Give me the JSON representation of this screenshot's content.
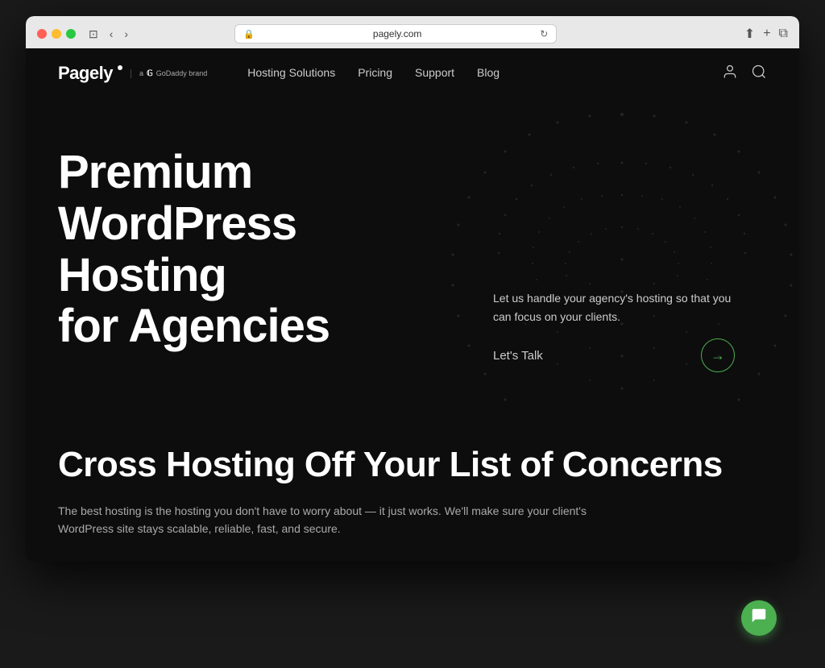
{
  "browser": {
    "url": "pagely.com",
    "tab_title": "pagely.com",
    "back_label": "‹",
    "forward_label": "›",
    "refresh_label": "↻"
  },
  "nav": {
    "logo": "Pagely",
    "godaddy_prefix": "a",
    "godaddy_label": "GoDaddy brand",
    "links": [
      {
        "label": "Hosting Solutions",
        "href": "#"
      },
      {
        "label": "Pricing",
        "href": "#"
      },
      {
        "label": "Support",
        "href": "#"
      },
      {
        "label": "Blog",
        "href": "#"
      }
    ]
  },
  "hero": {
    "title_line1": "Premium",
    "title_line2": "WordPress Hosting",
    "title_line3": "for Agencies",
    "description": "Let us handle your agency's hosting so that you can focus on your clients.",
    "cta_label": "Let's Talk",
    "cta_arrow": "→"
  },
  "section2": {
    "title": "Cross Hosting Off Your List of Concerns",
    "description": "The best hosting is the hosting you don't have to worry about — it just works. We'll make sure your client's WordPress site stays scalable, reliable, fast, and secure."
  },
  "chat": {
    "icon": "💬"
  }
}
